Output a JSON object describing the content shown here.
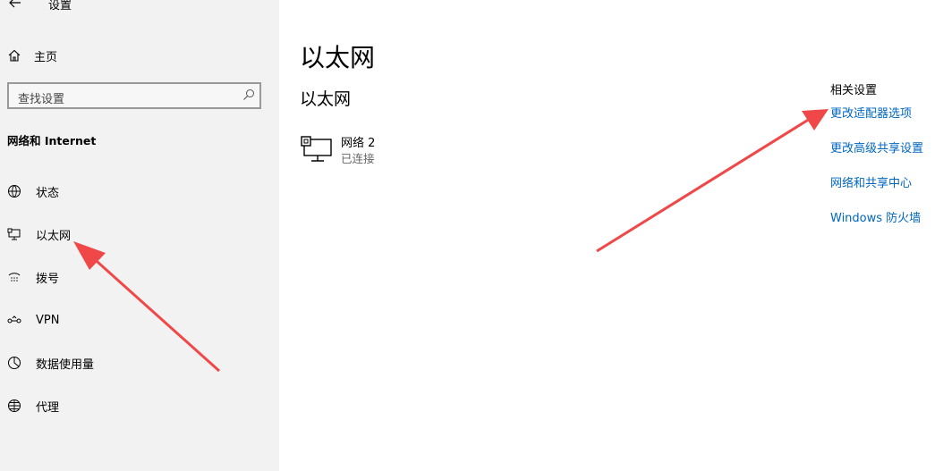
{
  "window": {
    "title": "设置"
  },
  "sidebar": {
    "home_label": "主页",
    "search": {
      "placeholder": "查找设置"
    },
    "section_title": "网络和 Internet",
    "items": [
      {
        "label": "状态",
        "icon": "network-status-icon"
      },
      {
        "label": "以太网",
        "icon": "ethernet-icon"
      },
      {
        "label": "拨号",
        "icon": "dial-up-icon"
      },
      {
        "label": "VPN",
        "icon": "vpn-icon"
      },
      {
        "label": "数据使用量",
        "icon": "data-usage-icon"
      },
      {
        "label": "代理",
        "icon": "proxy-globe-icon"
      }
    ]
  },
  "main": {
    "title": "以太网",
    "subtitle": "以太网",
    "network": {
      "name": "网络 2",
      "status": "已连接"
    }
  },
  "related": {
    "header": "相关设置",
    "links": [
      "更改适配器选项",
      "更改高级共享设置",
      "网络和共享中心",
      "Windows 防火墙"
    ]
  },
  "colors": {
    "link": "#0067c0",
    "sidebar_bg": "#f2f2f2",
    "annotation_arrow": "#f04848"
  }
}
